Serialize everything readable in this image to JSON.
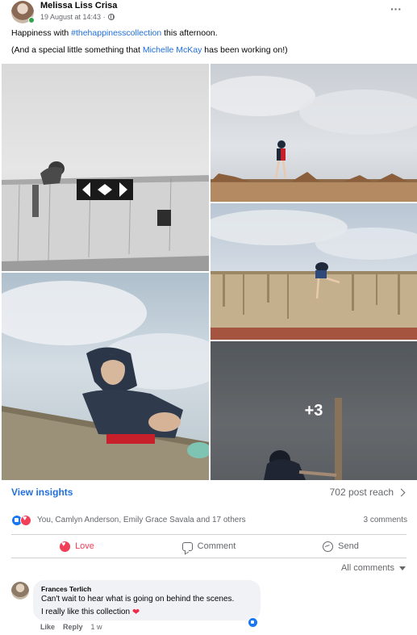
{
  "post": {
    "author": "Melissa Liss Crisa",
    "timestamp": "19 August at 14:43 ·",
    "privacy_icon": "globe-icon",
    "more_label": "···",
    "text_prefix": "Happiness with",
    "hashtag": "#thehappinesscollection",
    "text_suffix": "this afternoon.",
    "line2_prefix": "(And a special little something that",
    "mention": "Michelle McKay",
    "line2_suffix": "has been working on!)"
  },
  "gallery": {
    "photo_count": 5,
    "more_overlay": "+3"
  },
  "insights": {
    "view_label": "View insights",
    "reach": "702 post reach"
  },
  "reactions": {
    "summary": "You, Camlyn Anderson, Emily Grace Savala and 17 others",
    "comments": "3 comments",
    "types": [
      "like",
      "love"
    ]
  },
  "actions": {
    "love": "Love",
    "comment": "Comment",
    "send": "Send"
  },
  "comments_filter": "All comments",
  "comment": {
    "author": "Frances Terlich",
    "line1": "Can't wait to hear what is going on behind the scenes.",
    "line2": "I really like this collection",
    "like": "Like",
    "reply": "Reply",
    "age": "1 w"
  },
  "colors": {
    "link": "#216fdb",
    "love": "#f33e58",
    "like": "#1877f2",
    "muted": "#65676b"
  }
}
